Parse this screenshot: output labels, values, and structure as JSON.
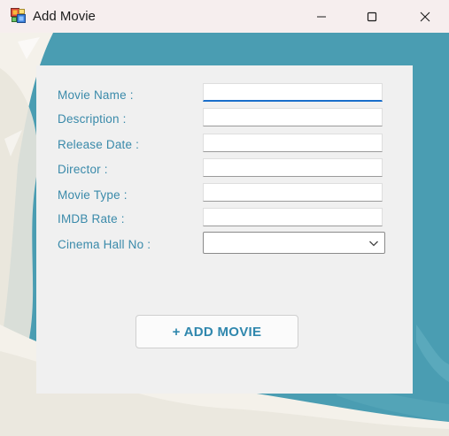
{
  "window": {
    "title": "Add Movie",
    "controls": {
      "minimize": "minimize",
      "maximize": "maximize",
      "close": "close"
    }
  },
  "form": {
    "fields": [
      {
        "label": "Movie Name :",
        "value": "",
        "focused": true
      },
      {
        "label": "Description :",
        "value": ""
      },
      {
        "label": "Release Date :",
        "value": ""
      },
      {
        "label": "Director :",
        "value": ""
      },
      {
        "label": "Movie Type :",
        "value": ""
      },
      {
        "label": "IMDB Rate :",
        "value": ""
      }
    ],
    "cinema_hall": {
      "label": "Cinema Hall No :",
      "selected": ""
    },
    "submit_label": "+ ADD MOVIE"
  },
  "colors": {
    "background_teal": "#4a9db2",
    "label_blue": "#3a8aaa",
    "focus_underline": "#1a6fcb",
    "titlebar": "#f6eeee"
  },
  "icons": [
    "app-icon",
    "minimize-icon",
    "maximize-icon",
    "close-icon",
    "chevron-down-icon"
  ]
}
